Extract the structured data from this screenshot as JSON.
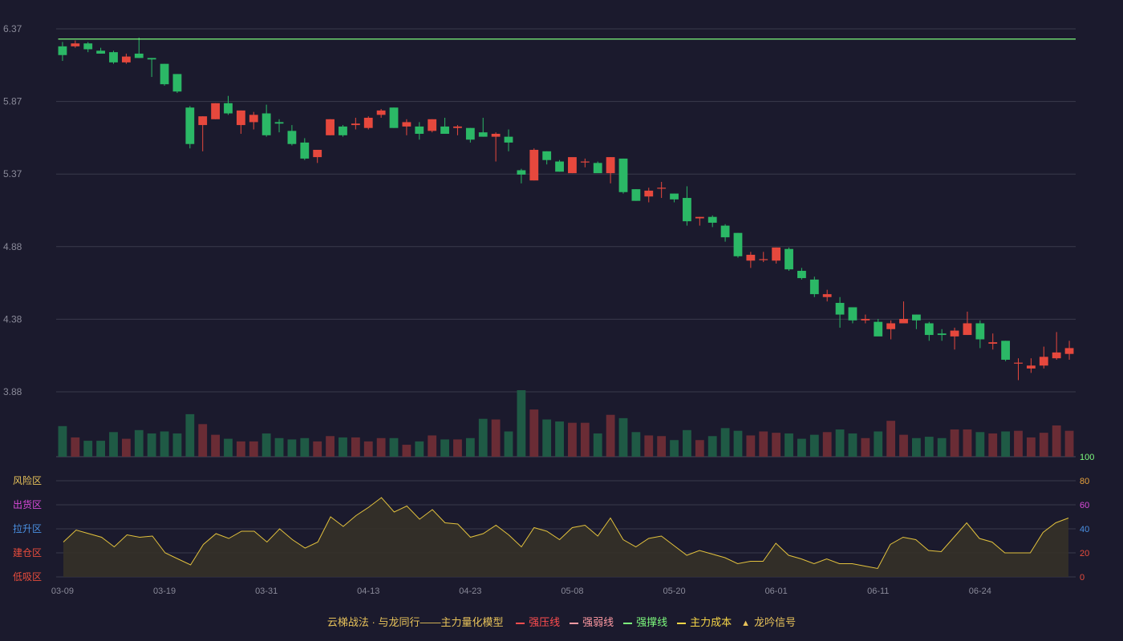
{
  "colors": {
    "background": "#1b1a2d",
    "grid": "#3a3a4c",
    "up": "#e6483d",
    "down": "#2bb866",
    "up_volume": "#6a2c35",
    "down_volume": "#1f5a45",
    "support_line": "#7dfa7d",
    "osc_line": "#e3c23d",
    "osc_fill": "#363328",
    "axis_text": "#8a8a99"
  },
  "legend": {
    "title": "云梯战法 · 与龙同行——主力量化模型",
    "items": [
      {
        "label": "强压线",
        "color": "#ff4d4f",
        "style": "solid"
      },
      {
        "label": "强弱线",
        "color": "#ff9aa2",
        "style": "dashed"
      },
      {
        "label": "强撑线",
        "color": "#7dfa7d",
        "style": "solid"
      },
      {
        "label": "主力成本",
        "color": "#f5d547",
        "style": "dashed"
      },
      {
        "label": "龙吟信号",
        "color": "#e8c35a",
        "style": "triangle",
        "icon": "triangle-icon"
      }
    ]
  },
  "zones": [
    {
      "label": "风险区",
      "color": "#e8c35a"
    },
    {
      "label": "出货区",
      "color": "#d94ad9"
    },
    {
      "label": "拉升区",
      "color": "#4a90e2"
    },
    {
      "label": "建仓区",
      "color": "#e74c3c"
    },
    {
      "label": "低吸区",
      "color": "#e74c3c"
    }
  ],
  "chart_data": {
    "type": "candlestick",
    "price_ticks": [
      "6.37",
      "5.87",
      "5.37",
      "4.88",
      "4.38",
      "3.88"
    ],
    "price_range": [
      3.88,
      6.37
    ],
    "osc_ticks": [
      {
        "label": "100",
        "color": "#7dfa7d"
      },
      {
        "label": "80",
        "color": "#e8a23c"
      },
      {
        "label": "60",
        "color": "#d94ad9"
      },
      {
        "label": "40",
        "color": "#4a90e2"
      },
      {
        "label": "20",
        "color": "#e74c3c"
      },
      {
        "label": "0",
        "color": "#e74c3c"
      }
    ],
    "osc_range": [
      0,
      100
    ],
    "x_ticks": [
      {
        "index": 0,
        "label": "03-09"
      },
      {
        "index": 8,
        "label": "03-19"
      },
      {
        "index": 16,
        "label": "03-31"
      },
      {
        "index": 24,
        "label": "04-13"
      },
      {
        "index": 32,
        "label": "04-23"
      },
      {
        "index": 40,
        "label": "05-08"
      },
      {
        "index": 48,
        "label": "05-20"
      },
      {
        "index": 56,
        "label": "06-01"
      },
      {
        "index": 64,
        "label": "06-11"
      },
      {
        "index": 72,
        "label": "06-24"
      }
    ],
    "support_level": 6.3,
    "ohlc": [
      [
        6.25,
        6.28,
        6.15,
        6.19
      ],
      [
        6.25,
        6.29,
        6.24,
        6.27
      ],
      [
        6.27,
        6.28,
        6.21,
        6.23
      ],
      [
        6.22,
        6.24,
        6.2,
        6.2
      ],
      [
        6.21,
        6.22,
        6.13,
        6.14
      ],
      [
        6.14,
        6.2,
        6.13,
        6.18
      ],
      [
        6.2,
        6.31,
        6.17,
        6.17
      ],
      [
        6.17,
        6.17,
        6.04,
        6.16
      ],
      [
        6.13,
        6.13,
        5.98,
        5.99
      ],
      [
        6.06,
        6.06,
        5.93,
        5.94
      ],
      [
        5.83,
        5.84,
        5.55,
        5.58
      ],
      [
        5.71,
        5.77,
        5.53,
        5.77
      ],
      [
        5.75,
        5.86,
        5.75,
        5.86
      ],
      [
        5.86,
        5.91,
        5.78,
        5.79
      ],
      [
        5.71,
        5.81,
        5.65,
        5.81
      ],
      [
        5.73,
        5.8,
        5.68,
        5.78
      ],
      [
        5.79,
        5.85,
        5.63,
        5.64
      ],
      [
        5.73,
        5.75,
        5.66,
        5.72
      ],
      [
        5.67,
        5.71,
        5.57,
        5.58
      ],
      [
        5.59,
        5.62,
        5.47,
        5.48
      ],
      [
        5.49,
        5.54,
        5.45,
        5.54
      ],
      [
        5.64,
        5.75,
        5.64,
        5.75
      ],
      [
        5.7,
        5.71,
        5.63,
        5.64
      ],
      [
        5.71,
        5.76,
        5.68,
        5.72
      ],
      [
        5.69,
        5.77,
        5.68,
        5.76
      ],
      [
        5.78,
        5.82,
        5.76,
        5.81
      ],
      [
        5.83,
        5.83,
        5.69,
        5.69
      ],
      [
        5.7,
        5.75,
        5.64,
        5.73
      ],
      [
        5.7,
        5.73,
        5.61,
        5.65
      ],
      [
        5.67,
        5.75,
        5.66,
        5.75
      ],
      [
        5.7,
        5.76,
        5.67,
        5.65
      ],
      [
        5.69,
        5.71,
        5.64,
        5.7
      ],
      [
        5.69,
        5.69,
        5.59,
        5.61
      ],
      [
        5.66,
        5.76,
        5.63,
        5.63
      ],
      [
        5.63,
        5.66,
        5.46,
        5.65
      ],
      [
        5.63,
        5.68,
        5.53,
        5.59
      ],
      [
        5.4,
        5.41,
        5.31,
        5.37
      ],
      [
        5.33,
        5.55,
        5.33,
        5.54
      ],
      [
        5.53,
        5.53,
        5.44,
        5.47
      ],
      [
        5.46,
        5.47,
        5.39,
        5.39
      ],
      [
        5.38,
        5.48,
        5.38,
        5.49
      ],
      [
        5.46,
        5.48,
        5.42,
        5.46
      ],
      [
        5.45,
        5.46,
        5.39,
        5.38
      ],
      [
        5.38,
        5.49,
        5.31,
        5.49
      ],
      [
        5.48,
        5.48,
        5.24,
        5.25
      ],
      [
        5.27,
        5.27,
        5.19,
        5.19
      ],
      [
        5.22,
        5.28,
        5.18,
        5.26
      ],
      [
        5.28,
        5.32,
        5.21,
        5.28
      ],
      [
        5.24,
        5.24,
        5.18,
        5.2
      ],
      [
        5.21,
        5.29,
        5.02,
        5.05
      ],
      [
        5.07,
        5.08,
        5.02,
        5.08
      ],
      [
        5.08,
        5.09,
        5.01,
        5.04
      ],
      [
        5.02,
        5.03,
        4.91,
        4.94
      ],
      [
        4.97,
        4.97,
        4.8,
        4.81
      ],
      [
        4.78,
        4.84,
        4.73,
        4.82
      ],
      [
        4.79,
        4.84,
        4.77,
        4.79
      ],
      [
        4.78,
        4.87,
        4.76,
        4.87
      ],
      [
        4.86,
        4.87,
        4.71,
        4.72
      ],
      [
        4.71,
        4.73,
        4.65,
        4.66
      ],
      [
        4.65,
        4.67,
        4.53,
        4.55
      ],
      [
        4.53,
        4.58,
        4.5,
        4.55
      ],
      [
        4.49,
        4.53,
        4.32,
        4.41
      ],
      [
        4.46,
        4.46,
        4.35,
        4.37
      ],
      [
        4.37,
        4.41,
        4.35,
        4.38
      ],
      [
        4.36,
        4.38,
        4.29,
        4.26
      ],
      [
        4.31,
        4.37,
        4.24,
        4.35
      ],
      [
        4.35,
        4.5,
        4.35,
        4.38
      ],
      [
        4.41,
        4.41,
        4.31,
        4.37
      ],
      [
        4.35,
        4.36,
        4.23,
        4.27
      ],
      [
        4.28,
        4.31,
        4.23,
        4.27
      ],
      [
        4.26,
        4.32,
        4.17,
        4.3
      ],
      [
        4.27,
        4.43,
        4.27,
        4.35
      ],
      [
        4.35,
        4.37,
        4.18,
        4.24
      ],
      [
        4.21,
        4.28,
        4.17,
        4.22
      ],
      [
        4.23,
        4.23,
        4.09,
        4.1
      ],
      [
        4.08,
        4.11,
        3.96,
        4.08
      ],
      [
        4.04,
        4.11,
        4.01,
        4.06
      ],
      [
        4.06,
        4.19,
        4.04,
        4.12
      ],
      [
        4.11,
        4.29,
        4.1,
        4.15
      ],
      [
        4.14,
        4.23,
        4.1,
        4.18
      ]
    ],
    "volume": [
      46,
      29,
      24,
      24,
      37,
      27,
      40,
      35,
      38,
      35,
      64,
      49,
      33,
      27,
      23,
      23,
      35,
      28,
      26,
      28,
      23,
      31,
      29,
      29,
      23,
      28,
      28,
      18,
      23,
      32,
      26,
      26,
      28,
      57,
      56,
      38,
      100,
      71,
      56,
      53,
      51,
      51,
      35,
      63,
      58,
      37,
      32,
      31,
      25,
      40,
      25,
      31,
      43,
      39,
      32,
      38,
      36,
      35,
      27,
      33,
      37,
      41,
      35,
      28,
      38,
      54,
      33,
      28,
      30,
      28,
      41,
      41,
      37,
      35,
      38,
      39,
      29,
      36,
      47,
      39
    ],
    "oscillator": [
      29,
      39,
      36,
      33,
      25,
      35,
      33,
      34,
      20,
      15,
      10,
      27,
      36,
      32,
      38,
      38,
      29,
      40,
      31,
      24,
      29,
      50,
      42,
      51,
      58,
      66,
      54,
      59,
      48,
      56,
      45,
      44,
      33,
      36,
      43,
      35,
      25,
      41,
      38,
      31,
      41,
      43,
      34,
      49,
      31,
      25,
      32,
      34,
      26,
      18,
      22,
      19,
      16,
      11,
      13,
      13,
      28,
      18,
      15,
      11,
      15,
      11,
      11,
      9,
      7,
      27,
      33,
      31,
      22,
      21,
      33,
      45,
      32,
      29,
      20,
      20,
      20,
      37,
      45,
      49
    ]
  }
}
